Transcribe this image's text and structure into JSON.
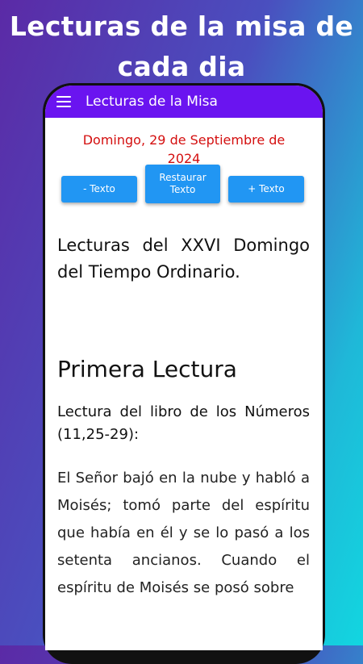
{
  "promo": {
    "title": "Lecturas de la misa de cada dia"
  },
  "appbar": {
    "title": "Lecturas de la Misa",
    "menu_icon": "hamburger-menu-icon"
  },
  "date": "Domingo, 29 de Septiembre de 2024",
  "buttons": {
    "decrease": "- Texto",
    "reset": "Restaurar Texto",
    "increase": "+ Texto"
  },
  "reading": {
    "title": "Lecturas del XXVI Domingo del Tiempo Ordinario.",
    "section": "Primera Lectura",
    "book_ref": "Lectura del libro de los Números (11,25-29):",
    "text": "El Señor bajó en la nube y habló a Moisés; tomó parte del espíritu que había en él y se lo pasó a los setenta ancianos. Cuando el espíritu de Moisés se posó sobre"
  },
  "colors": {
    "appbar": "#6a14f0",
    "date": "#d40f0f",
    "button": "#2196f3"
  }
}
